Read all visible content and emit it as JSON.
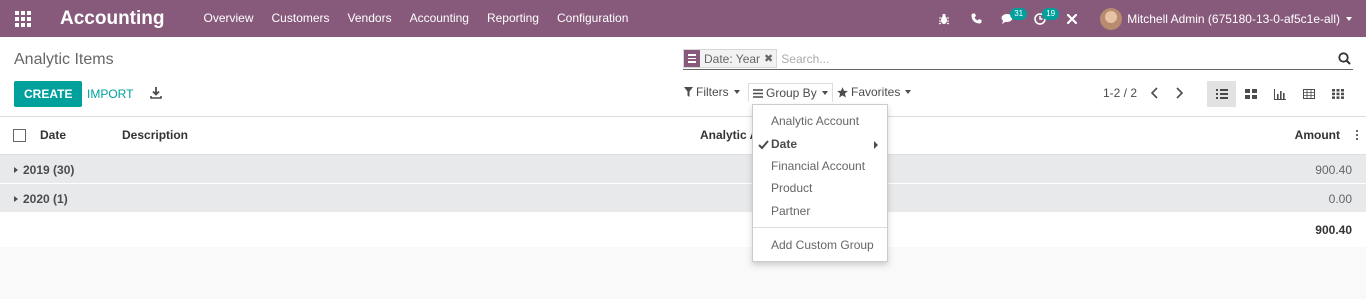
{
  "navbar": {
    "app_name": "Accounting",
    "menu": [
      "Overview",
      "Customers",
      "Vendors",
      "Accounting",
      "Reporting",
      "Configuration"
    ],
    "messages_count": "31",
    "activities_count": "19",
    "user_name": "Mitchell Admin (675180-13-0-af5c1e-all)"
  },
  "control": {
    "breadcrumb": "Analytic Items",
    "facet_value": "Date: Year",
    "facet_remove": "✖",
    "search_placeholder": "Search...",
    "create_label": "CREATE",
    "import_label": "IMPORT",
    "filters_label": "Filters",
    "groupby_label": "Group By",
    "favorites_label": "Favorites",
    "pager_value": "1-2 / 2"
  },
  "list": {
    "columns": {
      "date": "Date",
      "description": "Description",
      "analytic_account": "Analytic A",
      "amount": "Amount"
    },
    "groups": [
      {
        "label": "2019 (30)",
        "amount": "900.40"
      },
      {
        "label": "2020 (1)",
        "amount": "0.00"
      }
    ],
    "total": "900.40"
  },
  "groupby_menu": {
    "items": [
      "Analytic Account",
      "Date",
      "Financial Account",
      "Product",
      "Partner"
    ],
    "selected_index": 1,
    "custom_label": "Add Custom Group"
  },
  "colors": {
    "brand": "#875a7b",
    "primary": "#00a09d",
    "group_row": "#e8e9eb"
  }
}
